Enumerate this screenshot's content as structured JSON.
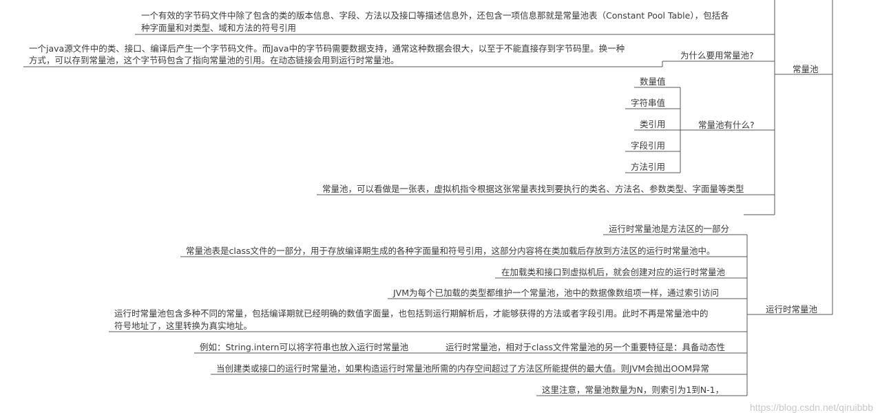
{
  "root_nodes": {
    "constant_pool": "常量池",
    "runtime_constant_pool": "运行时常量池"
  },
  "constant_pool_branch": {
    "desc_top_line1": "一个有效的字节码文件中除了包含的类的版本信息、字段、方法以及接口等描述信息外，还包含一项信息那就是常量池表（Constant Pool Table），包括各",
    "desc_top_line2": "种字面量和对类型、域和方法的符号引用",
    "why_label": "为什么要用常量池?",
    "why_desc_line1": "一个java源文件中的类、接口、编译后产生一个字节码文件。而Java中的字节码需要数据支持，通常这种数据会很大，以至于不能直接存到字节码里。换一种",
    "why_desc_line2": "方式，可以存到常量池，这个字节码包含了指向常量池的引用。在动态链接会用到运行时常量池。",
    "what_label": "常量池有什么?",
    "what_items": [
      "数量值",
      "字符串值",
      "类引用",
      "字段引用",
      "方法引用"
    ],
    "table_desc": "常量池，可以看做是一张表，虚拟机指令根据这张常量表找到要执行的类名、方法名、参数类型、字面量等类型"
  },
  "runtime_branch": {
    "items": [
      "运行时常量池是方法区的一部分",
      "常量池表是class文件的一部分，用于存放编译期生成的各种字面量和符号引用，这部分内容将在类加载后存放到方法区的运行时常量池中。",
      "在加载类和接口到虚拟机后，就会创建对应的运行时常量池",
      "JVM为每个已加载的类型都维护一个常量池，池中的数据像数组项一样，通过索引访问"
    ],
    "multi_line1": "运行时常量池包含多种不同的常量，包括编译期就已经明确的数值字面量，也包括到运行期解析后，才能够获得的方法或者字段引用。此时不再是常量池中的",
    "multi_line2": "符号地址了，这里转换为真实地址。",
    "dynamic_label": "运行时常量池，相对于class文件常量池的另一个重要特征是：具备动态性",
    "dynamic_example": "例如：String.intern可以将字符串也放入运行时常量池",
    "oom": "当创建类或接口的运行时常量池，如果构造运行时常量池所需的内存空间超过了方法区所能提供的最大值。则JVM会抛出OOM异常",
    "index_note": "这里注意，常量池数量为N，则索引为1到N-1，"
  },
  "watermark": "https://blog.csdn.net/qiruibbb"
}
